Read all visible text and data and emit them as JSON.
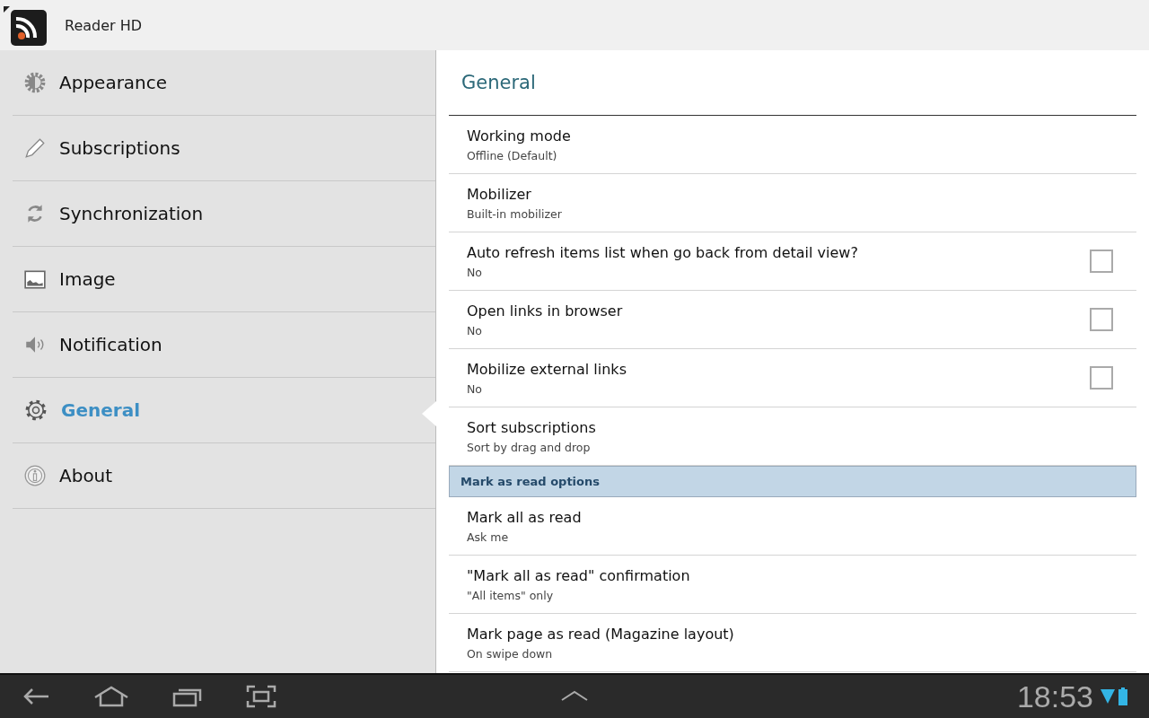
{
  "app_bar": {
    "title": "Reader HD"
  },
  "sidebar": {
    "items": [
      {
        "label": "Appearance",
        "kind": "appearance",
        "selected": false
      },
      {
        "label": "Subscriptions",
        "kind": "pencil",
        "selected": false
      },
      {
        "label": "Synchronization",
        "kind": "sync",
        "selected": false
      },
      {
        "label": "Image",
        "kind": "image",
        "selected": false
      },
      {
        "label": "Notification",
        "kind": "speaker",
        "selected": false
      },
      {
        "label": "General",
        "kind": "gear",
        "selected": true
      },
      {
        "label": "About",
        "kind": "info",
        "selected": false
      }
    ]
  },
  "panel": {
    "title": "General",
    "items": [
      {
        "kind": "pref",
        "title": "Working mode",
        "summary": "Offline (Default)"
      },
      {
        "kind": "pref",
        "title": "Mobilizer",
        "summary": "Built-in mobilizer"
      },
      {
        "kind": "checkbox",
        "title": "Auto refresh items list when go back from detail view?",
        "summary": "No",
        "checked": false
      },
      {
        "kind": "checkbox",
        "title": "Open links in browser",
        "summary": "No",
        "checked": false
      },
      {
        "kind": "checkbox",
        "title": "Mobilize external links",
        "summary": "No",
        "checked": false
      },
      {
        "kind": "pref",
        "title": "Sort subscriptions",
        "summary": "Sort by drag and drop"
      },
      {
        "kind": "category",
        "title": "Mark as read options"
      },
      {
        "kind": "pref",
        "title": "Mark all as read",
        "summary": "Ask me"
      },
      {
        "kind": "pref",
        "title": "\"Mark all as read\" confirmation",
        "summary": "\"All items\" only"
      },
      {
        "kind": "pref",
        "title": "Mark page as read (Magazine layout)",
        "summary": "On swipe down"
      }
    ]
  },
  "system_bar": {
    "time": "18:53"
  }
}
